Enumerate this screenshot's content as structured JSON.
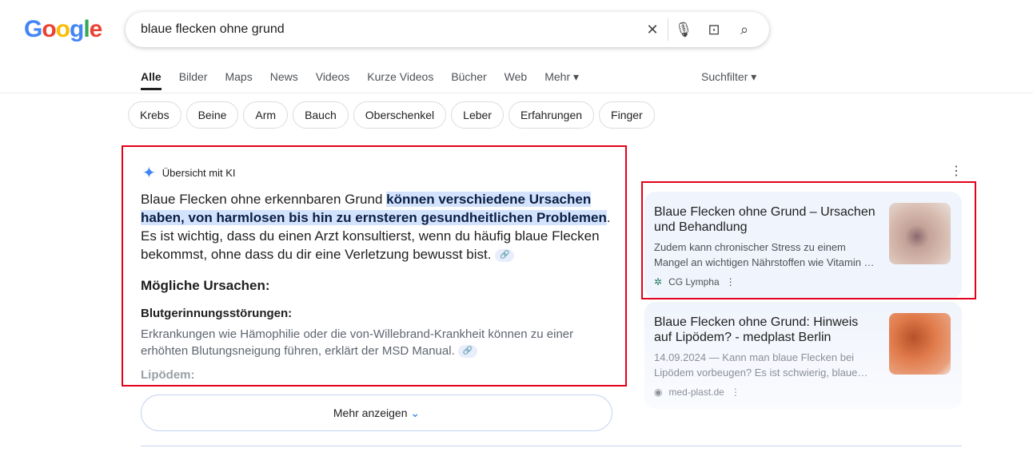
{
  "logo": "Google",
  "search": {
    "query": "blaue flecken ohne grund"
  },
  "tabs": [
    "Alle",
    "Bilder",
    "Maps",
    "News",
    "Videos",
    "Kurze Videos",
    "Bücher",
    "Web",
    "Mehr ▾"
  ],
  "filter": "Suchfilter ▾",
  "chips": [
    "Krebs",
    "Beine",
    "Arm",
    "Bauch",
    "Oberschenkel",
    "Leber",
    "Erfahrungen",
    "Finger"
  ],
  "ai": {
    "title": "Übersicht mit KI",
    "intro_start": "Blaue Flecken ohne erkennbaren Grund ",
    "intro_highlight": "können verschiedene Ursachen haben, von harmlosen bis hin zu ernsteren gesundheitlichen Problemen",
    "intro_end": ". Es ist wichtig, dass du einen Arzt konsultierst, wenn du häufig blaue Flecken bekommst, ohne dass du dir eine Verletzung bewusst bist.",
    "causes_heading": "Mögliche Ursachen:",
    "cause1_title": "Blutgerinnungsstörungen:",
    "cause1_text": "Erkrankungen wie Hämophilie oder die von-Willebrand-Krankheit können zu einer erhöhten Blutungsneigung führen, erklärt der MSD Manual.",
    "cause2_title": "Lipödem:",
    "more": "Mehr anzeigen"
  },
  "sources": [
    {
      "title": "Blaue Flecken ohne Grund – Ursachen und Behandlung",
      "snippet": "Zudem kann chronischer Stress zu einem Mangel an wichtigen Nährstoffen wie Vitamin …",
      "site": "CG Lympha"
    },
    {
      "title": "Blaue Flecken ohne Grund: Hinweis auf Lipödem? - medplast Berlin",
      "snippet": "14.09.2024 — Kann man blaue Flecken bei Lipödem vorbeugen? Es ist schwierig, blaue…",
      "site": "med-plast.de"
    }
  ]
}
